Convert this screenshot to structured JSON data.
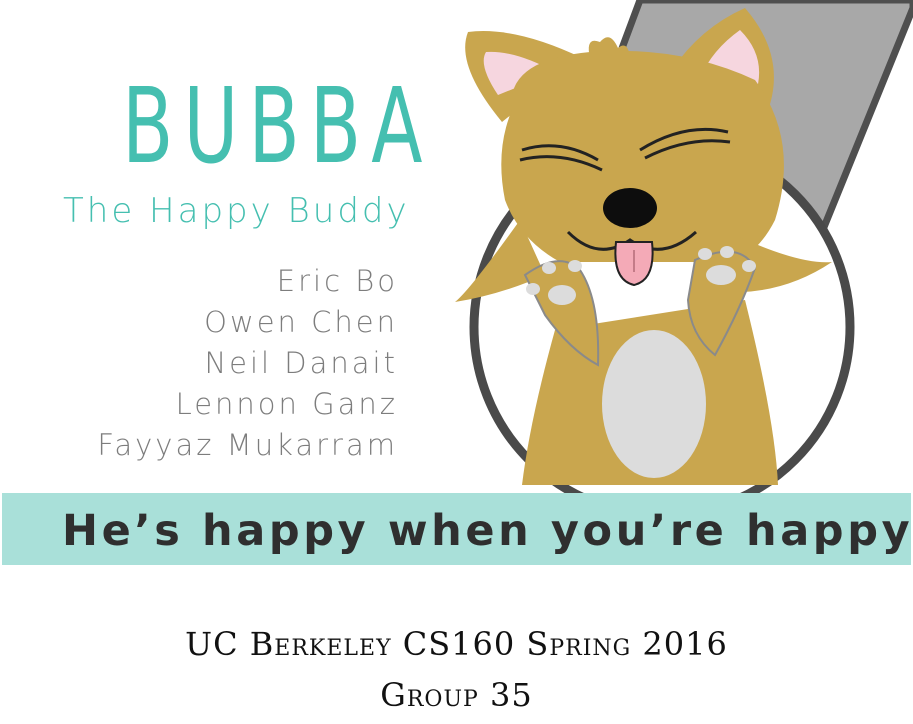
{
  "poster": {
    "title": "BUBBA",
    "subtitle": "The Happy Buddy",
    "members": [
      "Eric Bo",
      "Owen Chen",
      "Neil Danait",
      "Lennon Ganz",
      "Fayyaz Mukarram"
    ],
    "tagline": "He’s happy when you’re happy.",
    "course": "UC Berkeley CS160 Spring 2016",
    "group": "Group 35"
  },
  "illustration": {
    "subject": "dog-mascot",
    "icons": [
      "dog-mascot-icon",
      "leash-icon"
    ]
  },
  "colors": {
    "accent_teal": "#45bfb0",
    "band_teal": "#a9e0d9",
    "dog_fur": "#c9a64e",
    "leash_gray": "#a8a8a8",
    "ring_dark": "#4a4a4a",
    "member_gray": "#7d7d7d"
  }
}
